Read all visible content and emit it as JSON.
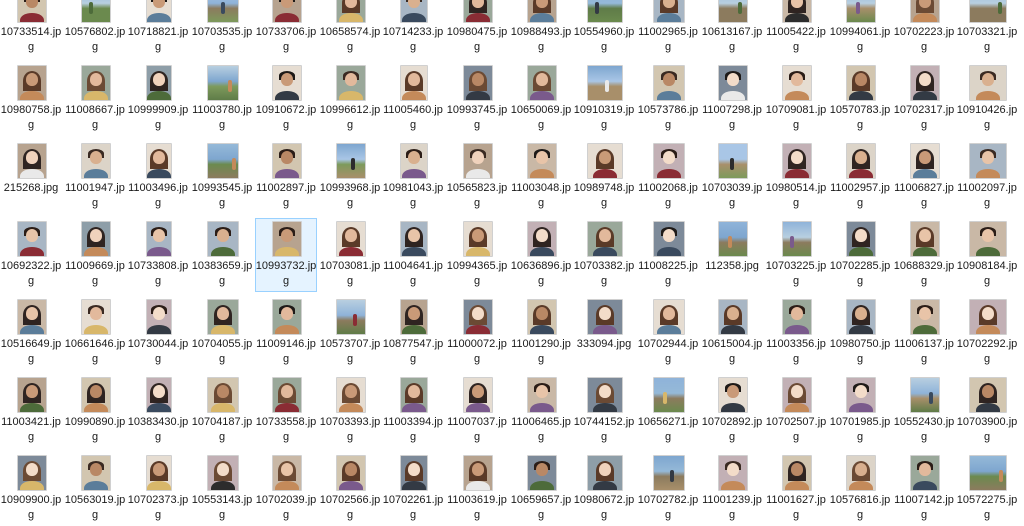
{
  "window": {
    "view": "large-icons",
    "selected_file": "10993732.jpg",
    "selection_color": "#99d1ff"
  },
  "files": [
    [
      "10733514.jpg",
      "10576802.jpg",
      "10718821.jpg",
      "10703535.jpg",
      "10733706.jpg",
      "10658574.jpg",
      "10714233.jpg",
      "10980475.jpg",
      "10988493.jpg",
      "10554960.jpg",
      "11002965.jpg",
      "10613167.jpg",
      "11005422.jpg",
      "10994061.jpg",
      "10702223.jpg",
      "10703321.jpg"
    ],
    [
      "10980758.jpg",
      "11008667.jpg",
      "10999909.jpg",
      "11003780.jpg",
      "10910672.jpg",
      "10996612.jpg",
      "11005460.jpg",
      "10993745.jpg",
      "10650069.jpg",
      "10910319.jpg",
      "10573786.jpg",
      "11007298.jpg",
      "10709081.jpg",
      "10570783.jpg",
      "10702317.jpg",
      "10910426.jpg"
    ],
    [
      "215268.jpg",
      "11001947.jpg",
      "11003496.jpg",
      "10993545.jpg",
      "11002897.jpg",
      "10993968.jpg",
      "10981043.jpg",
      "10565823.jpg",
      "11003048.jpg",
      "10989748.jpg",
      "11002068.jpg",
      "10703039.jpg",
      "10980514.jpg",
      "11002957.jpg",
      "11006827.jpg",
      "11002097.jpg"
    ],
    [
      "10692322.jpg",
      "11009669.jpg",
      "10733808.jpg",
      "10383659.jpg",
      "10993732.jpg",
      "10703081.jpg",
      "11004641.jpg",
      "10994365.jpg",
      "10636896.jpg",
      "10703382.jpg",
      "11008225.jpg",
      "112358.jpg",
      "10703225.jpg",
      "10702285.jpg",
      "10688329.jpg",
      "10908184.jpg"
    ],
    [
      "10516649.jpg",
      "10661646.jpg",
      "10730044.jpg",
      "10704055.jpg",
      "11009146.jpg",
      "10573707.jpg",
      "10877547.jpg",
      "11000072.jpg",
      "11001290.jpg",
      "333094.jpg",
      "10702944.jpg",
      "10615004.jpg",
      "11003356.jpg",
      "10980750.jpg",
      "11006137.jpg",
      "10702292.jpg"
    ],
    [
      "11003421.jpg",
      "10990890.jpg",
      "10383430.jpg",
      "10704187.jpg",
      "10733558.jpg",
      "10703393.jpg",
      "11003394.jpg",
      "11007037.jpg",
      "11006465.jpg",
      "10744152.jpg",
      "10656271.jpg",
      "10702892.jpg",
      "10702507.jpg",
      "10701985.jpg",
      "10552430.jpg",
      "10703900.jpg"
    ],
    [
      "10909900.jpg",
      "10563019.jpg",
      "10702373.jpg",
      "10553143.jpg",
      "10702039.jpg",
      "10702566.jpg",
      "10702261.jpg",
      "11003619.jpg",
      "10659657.jpg",
      "10980672.jpg",
      "10702782.jpg",
      "11001239.jpg",
      "11001627.jpg",
      "10576816.jpg",
      "11007142.jpg",
      "10572275.jpg"
    ]
  ],
  "thumbnails": [
    [
      "person",
      "landscape",
      "person",
      "landscape",
      "person",
      "person",
      "person",
      "person",
      "person",
      "landscape",
      "person",
      "landscape",
      "person",
      "landscape",
      "person",
      "landscape"
    ],
    [
      "person",
      "person",
      "person",
      "landscape",
      "person",
      "person",
      "person",
      "person",
      "person",
      "landscape",
      "person",
      "person",
      "person",
      "person",
      "person",
      "person"
    ],
    [
      "person",
      "person",
      "person",
      "landscape",
      "person",
      "landscape",
      "person",
      "person",
      "person",
      "person",
      "person",
      "landscape",
      "person",
      "person",
      "person",
      "person"
    ],
    [
      "person",
      "person",
      "person",
      "person",
      "person",
      "person",
      "person",
      "person",
      "person",
      "person",
      "person",
      "landscape",
      "landscape",
      "person",
      "person",
      "person"
    ],
    [
      "person",
      "person",
      "person",
      "person",
      "person",
      "landscape",
      "person",
      "person",
      "person",
      "person",
      "person",
      "person",
      "person",
      "person",
      "person",
      "person"
    ],
    [
      "person",
      "person",
      "person",
      "person",
      "person",
      "person",
      "person",
      "person",
      "person",
      "person",
      "landscape",
      "person",
      "person",
      "person",
      "landscape",
      "person"
    ],
    [
      "person",
      "person",
      "person",
      "person",
      "person",
      "person",
      "person",
      "person",
      "person",
      "person",
      "landscape",
      "person",
      "person",
      "person",
      "person",
      "landscape"
    ]
  ]
}
